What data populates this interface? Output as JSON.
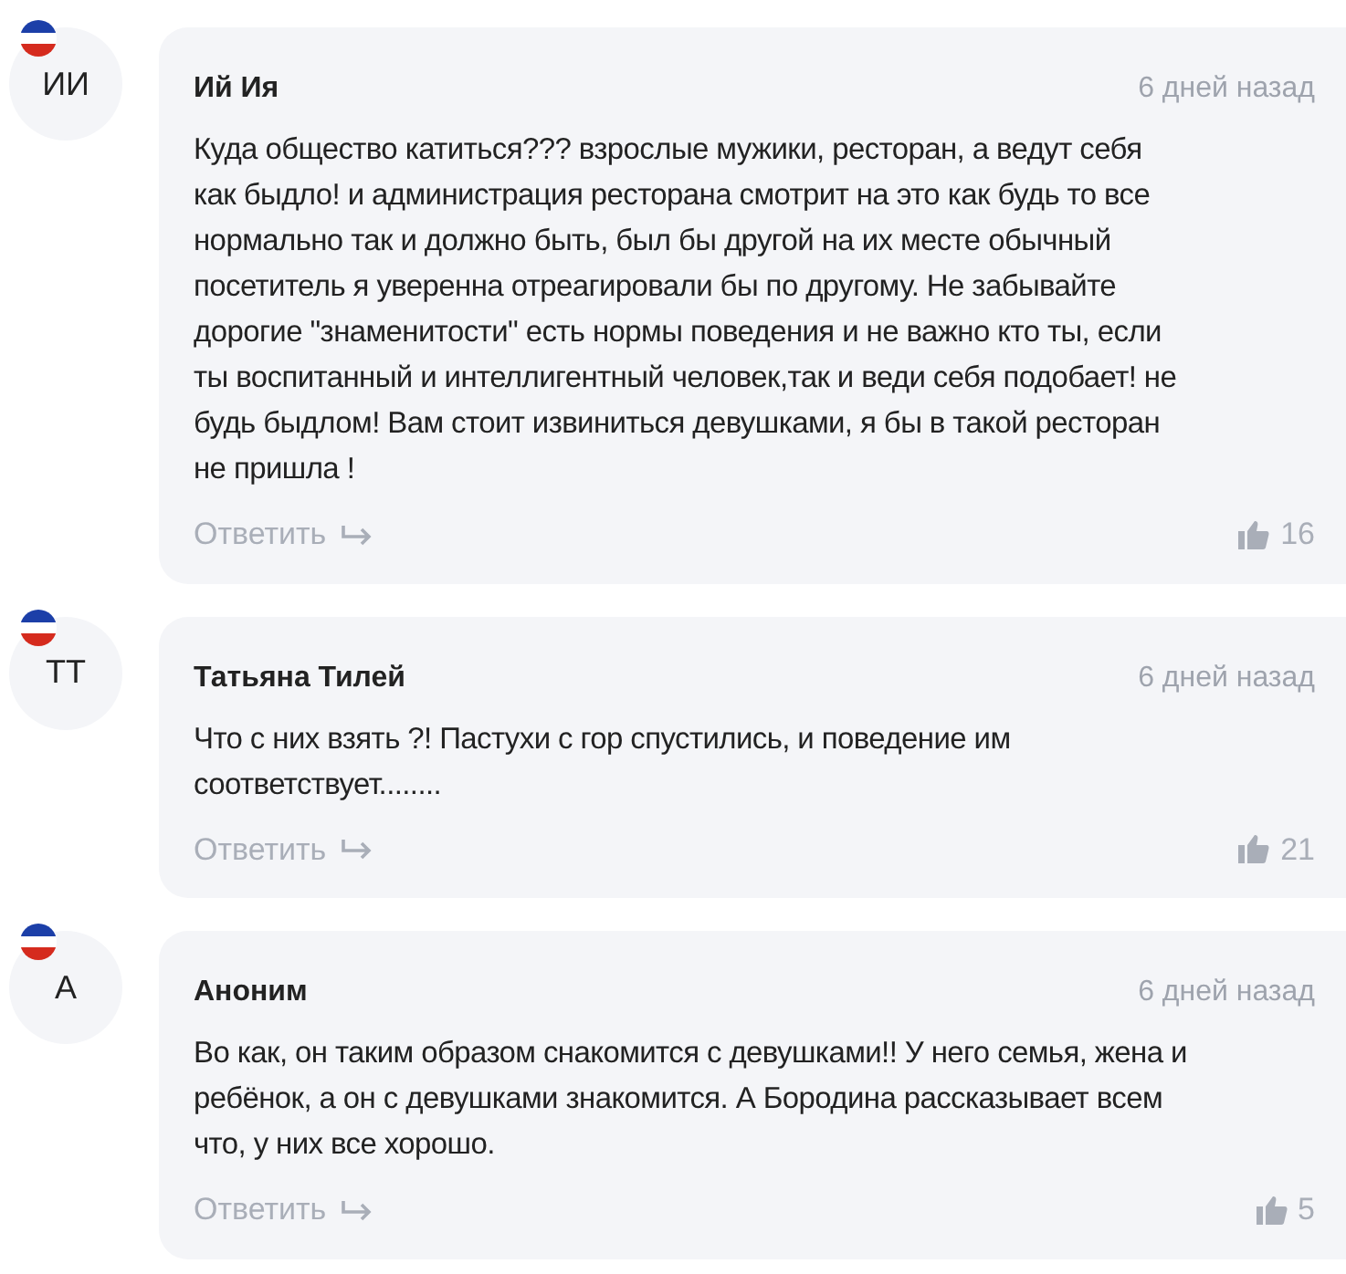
{
  "comments": [
    {
      "initials": "ИИ",
      "author": "Ий Ия",
      "time": "6 дней назад",
      "text": "Куда общество катиться??? взрослые мужики, ресторан, а ведут себя как быдло! и администрация ресторана смотрит на это как будь то все нормально так и должно быть, был бы другой на их месте обычный посетитель я уверенна отреагировали бы по другому. Не забывайте дорогие \"знаменитости\" есть нормы поведения и не важно кто ты, если ты воспитанный и интеллигентный человек,так и веди себя подобает! не будь быдлом! Вам стоит извиниться девушками, я бы в такой ресторан не пришла !",
      "reply": "Ответить",
      "likes": "16"
    },
    {
      "initials": "ТТ",
      "author": "Татьяна Тилей",
      "time": "6 дней назад",
      "text": "Что с них взять ?! Пастухи с гор спустились, и поведение им соответствует........",
      "reply": "Ответить",
      "likes": "21"
    },
    {
      "initials": "А",
      "author": "Аноним",
      "time": "6 дней назад",
      "text": "Во как, он таким образом снакомится с девушками!! У него семья, жена и ребёнок, а он с девушками знакомится. А Бородина рассказывает всем что, у них все хорошо.",
      "reply": "Ответить",
      "likes": "5"
    }
  ]
}
